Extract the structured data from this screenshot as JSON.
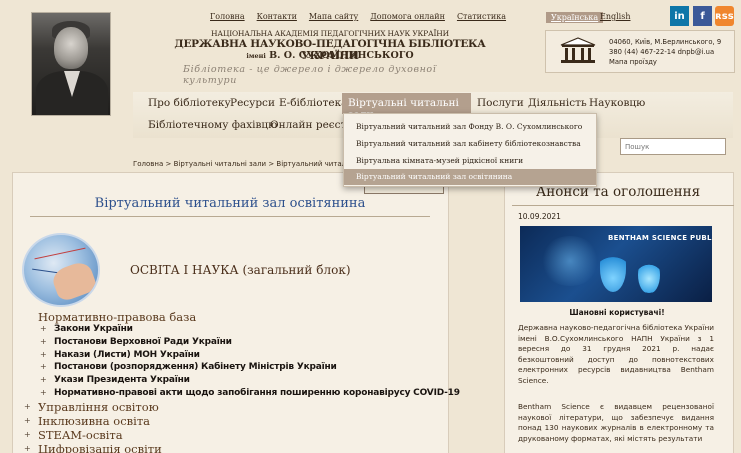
{
  "header": {
    "top_links": [
      "Головна",
      "Контакти",
      "Мапа сайту",
      "Допомога онлайн",
      "Статистика"
    ],
    "org_line1": "НАЦІОНАЛЬНА АКАДЕМІЯ ПЕДАГОГІЧНИХ НАУК УКРАЇНИ",
    "org_line2": "ДЕРЖАВНА НАУКОВО-ПЕДАГОГІЧНА БІБЛІОТЕКА УКРАЇНИ",
    "org_line3_prefix": "імені",
    "org_line3_name": "В. О. СУХОМЛИНСЬКОГО",
    "slogan": "Бібліотека - це джерело і джерело духовної культури",
    "lang_uk": "Українська",
    "lang_en": "English",
    "social": {
      "linkedin": "in",
      "facebook": "f",
      "rss": "ʀss"
    },
    "contact": {
      "address": "04060, Київ, М.Берлинського, 9",
      "phone_email": "380 (44) 467-22-14 dnpb@i.ua",
      "map": "Мапа проїзду"
    }
  },
  "nav": {
    "items": [
      "Про бібліотеку",
      "Ресурси",
      "Е-бібліотека",
      "Віртуальні читальні зали",
      "Послуги",
      "Діяльність",
      "Науковцю",
      "Бібліотечному фахівцю",
      "Онлайн реєстр"
    ],
    "active_label": "Віртуальні читальні зали",
    "search_placeholder": "Пошук",
    "dropdown": [
      "Віртуальний читальний зал Фонду В. О. Сухомлинського",
      "Віртуальний читальний зал кабінету бібліотекознавства",
      "Віртуальна кімната-музей рідкісної книги",
      "Віртуальний читальний зал освітянина"
    ]
  },
  "breadcrumb": "Головна > Віртуальні читальні зали > Віртуальний читальний зал освітянина",
  "main": {
    "back_button": "НАЗАД",
    "title": "Віртуальний читальний зал освітянина",
    "section_heading": "ОСВІТА І НАУКА (загальний блок)",
    "group_heading": "Нормативно-правова база",
    "sub_items": [
      "Закони України",
      "Постанови Верховної Ради України",
      "Накази (Листи) МОН України",
      "Постанови (розпорядження) Кабінету Міністрів України",
      "Укази Президента України",
      "Нормативно-правові акти щодо запобігання поширенню коронавірусу COVID-19"
    ],
    "categories": [
      "Управління освітою",
      "Інклюзивна освіта",
      "STEAM-освіта",
      "Цифровізація освіти"
    ]
  },
  "announcements": {
    "title": "Анонси та оголошення",
    "date": "10.09.2021",
    "image_label": "BENTHAM SCIENCE PUBLISHERS",
    "greeting": "Шановні користувачі!",
    "body1": "Державна науково-педагогічна бібліотека України імені В.О.Сухомлинського НАПН України з 1 вересня до 31 грудня 2021 р. надає безкоштовний доступ до повнотекстових електронних ресурсів видавництва Bentham Science.",
    "body2": "Bentham Science є видавцем рецензованої наукової літератури, що забезпечує видання понад 130 наукових журналів в електронному та друкованому форматах, які містять результати"
  }
}
